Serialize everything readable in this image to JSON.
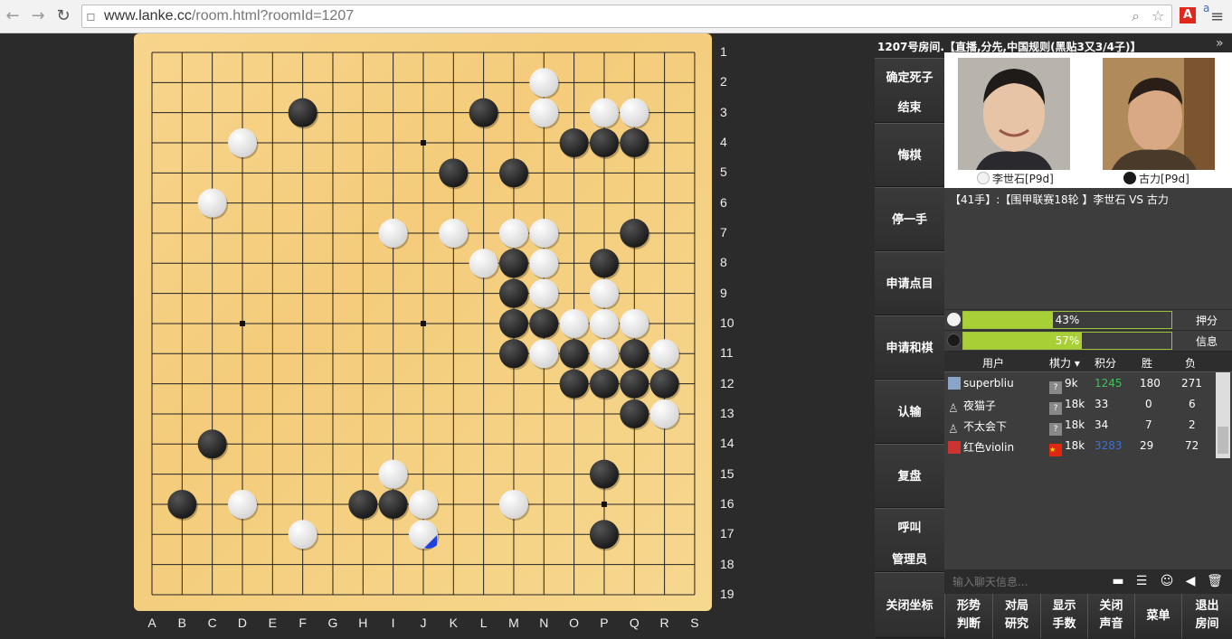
{
  "browser": {
    "url_host": "www.lanke.cc",
    "url_path": "/room.html?roomId=1207"
  },
  "board": {
    "size": 19,
    "columns": [
      "A",
      "B",
      "C",
      "D",
      "E",
      "F",
      "G",
      "H",
      "I",
      "J",
      "K",
      "L",
      "M",
      "N",
      "O",
      "P",
      "Q",
      "R",
      "S"
    ],
    "rows": [
      "1",
      "2",
      "3",
      "4",
      "5",
      "6",
      "7",
      "8",
      "9",
      "10",
      "11",
      "12",
      "13",
      "14",
      "15",
      "16",
      "17",
      "18",
      "19"
    ],
    "black_stones": [
      "F3",
      "L3",
      "O4",
      "P4",
      "Q4",
      "K5",
      "M5",
      "Q7",
      "M8",
      "P8",
      "M9",
      "M10",
      "N10",
      "M11",
      "O11",
      "Q11",
      "O12",
      "P12",
      "Q12",
      "R12",
      "Q13",
      "C14",
      "P15",
      "B16",
      "H16",
      "I16",
      "P17"
    ],
    "white_stones": [
      "N2",
      "N3",
      "P3",
      "Q3",
      "D4",
      "C6",
      "I7",
      "K7",
      "M7",
      "N7",
      "L8",
      "N8",
      "N9",
      "P9",
      "O10",
      "P10",
      "Q10",
      "N11",
      "P11",
      "R11",
      "R13",
      "I15",
      "D16",
      "J16",
      "M16",
      "F17",
      "J17"
    ],
    "last_move": "J17",
    "star_points": [
      "J4",
      "D10",
      "J10",
      "P16"
    ]
  },
  "room": {
    "title": "1207号房间.【直播,分先,中国规则(黑贴3又3/4子)】"
  },
  "menu": [
    "确定死子",
    "结束",
    "悔棋",
    "停一手",
    "申请点目",
    "申请和棋",
    "认输",
    "复盘",
    "呼叫",
    "管理员",
    "关闭坐标"
  ],
  "players": {
    "white": {
      "name": "李世石[P9d]"
    },
    "black": {
      "name": "古力[P9d]"
    }
  },
  "game_info": "【41手】:【围甲联赛18轮 】李世石 VS 古力",
  "votes": {
    "white_percent": 43,
    "white_text": "43%",
    "black_percent": 57,
    "black_text": "57%",
    "label_top": "押分",
    "label_bottom": "信息"
  },
  "users": {
    "headers": {
      "user": "用户",
      "rank": "棋力",
      "score": "积分",
      "win": "胜",
      "loss": "负"
    },
    "rows": [
      {
        "name": "superbliu",
        "rank": "9k",
        "score": "1245",
        "win": "180",
        "loss": "271",
        "score_color": "#3fc25a"
      },
      {
        "name": "夜猫子",
        "rank": "18k",
        "score": "33",
        "win": "0",
        "loss": "6",
        "score_color": "#ffffff"
      },
      {
        "name": "不太会下",
        "rank": "18k",
        "score": "34",
        "win": "7",
        "loss": "2",
        "score_color": "#ffffff"
      },
      {
        "name": "红色violin",
        "rank": "18k",
        "score": "3283",
        "win": "29",
        "loss": "72",
        "score_color": "#3a6fd8"
      }
    ]
  },
  "chat": {
    "placeholder": "输入聊天信息..."
  },
  "bottom_buttons": [
    {
      "line1": "形势",
      "line2": "判断"
    },
    {
      "line1": "对局",
      "line2": "研究"
    },
    {
      "line1": "显示",
      "line2": "手数"
    },
    {
      "line1": "关闭",
      "line2": "声音"
    },
    {
      "line1": "菜单",
      "line2": ""
    },
    {
      "line1": "退出",
      "line2": "房间"
    }
  ],
  "colors": {
    "black_stone": "#1a1a1a",
    "white_stone": "#f2f2f2",
    "last_move_marker": "#1f3fe0",
    "vote_fill": "#a9cf37"
  }
}
